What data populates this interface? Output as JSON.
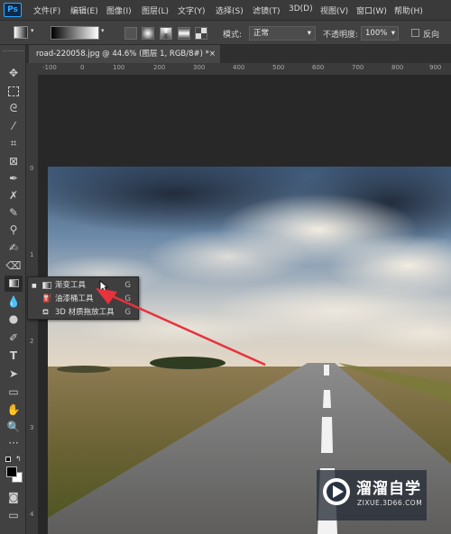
{
  "app": {
    "logo": "Ps"
  },
  "menu": [
    "文件(F)",
    "编辑(E)",
    "图像(I)",
    "图层(L)",
    "文字(Y)",
    "选择(S)",
    "滤镜(T)",
    "3D(D)",
    "视图(V)",
    "窗口(W)",
    "帮助(H)"
  ],
  "options": {
    "mode_label": "模式:",
    "mode_value": "正常",
    "opacity_label": "不透明度:",
    "opacity_value": "100%",
    "reverse_label": "反向"
  },
  "document": {
    "tab_title": "road-220058.jpg @ 44.6% (图层 1, RGB/8#) *",
    "close": "×"
  },
  "ruler": {
    "top": [
      "-100",
      "0",
      "100",
      "200",
      "300",
      "400",
      "500",
      "600",
      "700",
      "800",
      "900"
    ],
    "left": [
      "0",
      "1",
      "2",
      "3",
      "4"
    ]
  },
  "flyout": {
    "items": [
      {
        "label": "渐变工具",
        "shortcut": "G",
        "selected": true
      },
      {
        "label": "油漆桶工具",
        "shortcut": "G",
        "selected": false
      },
      {
        "label": "3D 材质拖放工具",
        "shortcut": "G",
        "selected": false
      }
    ]
  },
  "watermark": {
    "brand": "溜溜自学",
    "url": "ZIXUE.3D66.COM"
  },
  "colors": {
    "accent": "#31a8ff",
    "arrow": "#e8323c",
    "panel": "#414141"
  }
}
